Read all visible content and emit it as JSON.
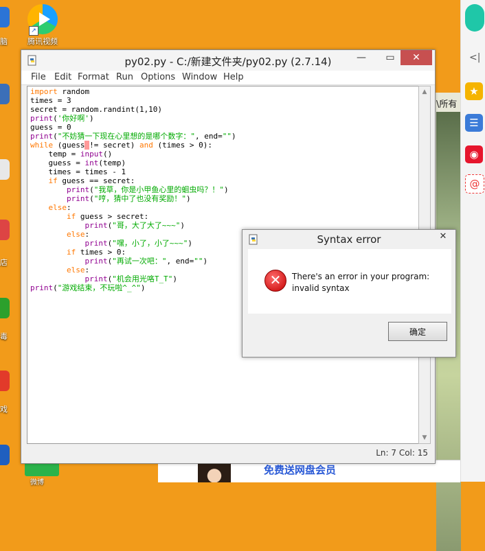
{
  "desktop": {
    "top_left_label": "脑",
    "tencent_video_label": "腾讯视频",
    "left_edge_labels": [
      "店",
      "毒",
      "戏"
    ],
    "bottom_icon_label": "微博"
  },
  "background_window": {
    "text": "\\所有"
  },
  "ad": {
    "text": "免费送网盘会员"
  },
  "idle": {
    "title": "py02.py - C:/新建文件夹/py02.py (2.7.14)",
    "menu": [
      "File",
      "Edit",
      "Format",
      "Run",
      "Options",
      "Window",
      "Help"
    ],
    "status": "Ln: 7   Col: 15",
    "code_lines": [
      "import random",
      "times = 3",
      "secret = random.randint(1,10)",
      "print('你好啊')",
      "guess = 0",
      "print(\"不妨猜一下现在心里想的是哪个数字：\", end=\"\")",
      "while (guess != secret) and (times > 0):",
      "    temp = input()",
      "    guess = int(temp)",
      "    times = times - 1",
      "    if guess == secret:",
      "        print(\"我草，你是小甲鱼心里的蛔虫吗？！\")",
      "        print(\"哼，猜中了也没有奖励！\")",
      "    else:",
      "        if guess > secret:",
      "            print(\"哥，大了大了~~~\")",
      "        else:",
      "            print(\"嘿，小了，小了~~~\")",
      "        if times > 0:",
      "            print(\"再试一次吧：\", end=\"\")",
      "        else:",
      "            print(\"机会用光咯T_T\")",
      "print(\"游戏结束，不玩啦^_^\")"
    ]
  },
  "dialog": {
    "title": "Syntax error",
    "message_line1": "There's an error in your program:",
    "message_line2": "invalid syntax",
    "ok_label": "确定"
  },
  "colors": {
    "desktop_bg": "#f29b1a",
    "keyword": "#ff7700",
    "builtin": "#900090",
    "string": "#00aa00",
    "error_highlight": "#ff9a9a"
  }
}
